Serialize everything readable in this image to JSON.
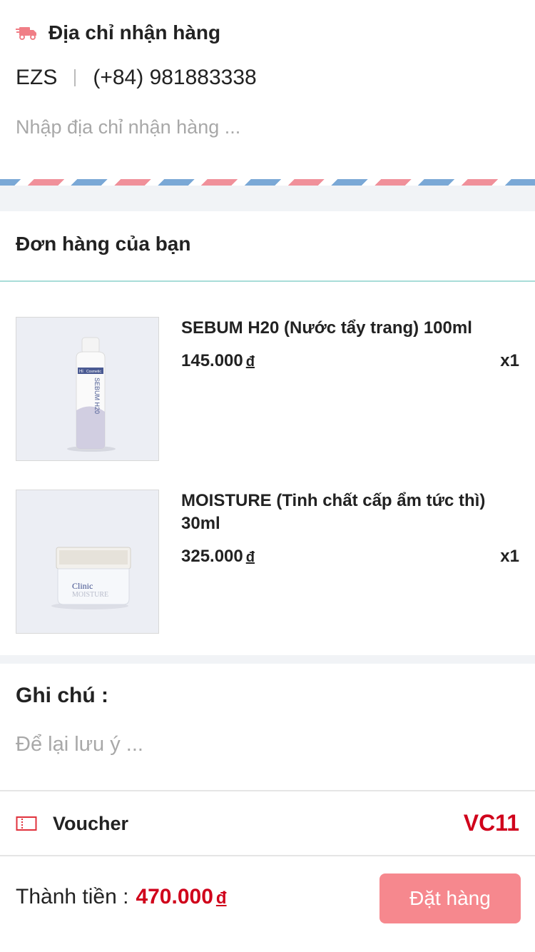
{
  "address": {
    "title": "Địa chỉ nhận hàng",
    "name": "EZS",
    "phone": "(+84) 981883338",
    "placeholder": "Nhập địa chỉ nhận hàng ..."
  },
  "order": {
    "title": "Đơn hàng của bạn",
    "items": [
      {
        "name": "SEBUM H20 (Nước tẩy trang) 100ml",
        "price": "145.000",
        "currency": "đ",
        "qty": "x1",
        "image_text": [
          "Hi",
          "Cosmetic",
          "SEBUM H20"
        ]
      },
      {
        "name": "MOISTURE (Tinh chất cấp ẩm tức thì) 30ml",
        "price": "325.000",
        "currency": "đ",
        "qty": "x1",
        "image_text": [
          "Clinic",
          "MOISTURE"
        ]
      }
    ]
  },
  "note": {
    "title": "Ghi chú :",
    "placeholder": "Để lại lưu ý ..."
  },
  "voucher": {
    "label": "Voucher",
    "code": "VC11"
  },
  "footer": {
    "total_label": "Thành tiền :",
    "total_value": "470.000",
    "currency": "đ",
    "order_button": "Đặt hàng"
  },
  "colors": {
    "accent_red": "#d0021b",
    "button_pink": "#f6888e",
    "airmail_blue": "#7aa8d6",
    "airmail_pink": "#f0909a",
    "divider_teal": "#a8ddd8"
  },
  "icons": {
    "address": "truck-icon",
    "voucher": "ticket-icon"
  }
}
